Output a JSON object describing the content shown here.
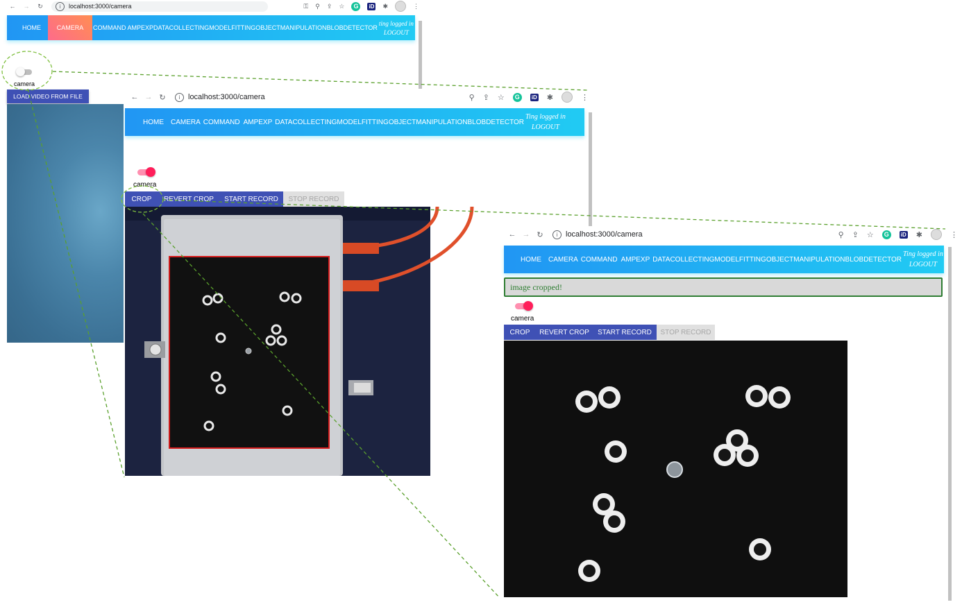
{
  "browser": {
    "url": "localhost:3000/camera"
  },
  "nav": {
    "home": "HOME",
    "camera": "CAMERA",
    "command": "COMMAND",
    "ampexp": "AMPEXP",
    "datacollecting": "DATACOLLECTING",
    "modelfitting": "MODELFITTING",
    "objectmanipulation": "OBJECTMANIPULATION",
    "blobdetector": "BLOBDETECTOR",
    "logout": "LOGOUT",
    "user_status_win1": "ting logged in",
    "user_status": "Ting logged in"
  },
  "win1": {
    "toggle_label": "camera",
    "load_video_button": "LOAD VIDEO FROM FILE"
  },
  "win2": {
    "toggle_label": "camera",
    "buttons": [
      "CROP",
      "REVERT CROP",
      "START RECORD",
      "STOP RECORD"
    ]
  },
  "win3": {
    "alert": "image cropped!",
    "toggle_label": "camera",
    "buttons": [
      "CROP",
      "REVERT CROP",
      "START RECORD",
      "STOP RECORD"
    ]
  },
  "colors": {
    "nav_gradient_start": "#2196f3",
    "nav_gradient_end": "#21cbf3",
    "camera_active_tab": "#fe6b8b",
    "button_primary": "#3f51b5",
    "toggle_on": "#ff1e5a",
    "alert_border": "#2e7d32",
    "callout_dash": "#5aa02c"
  }
}
